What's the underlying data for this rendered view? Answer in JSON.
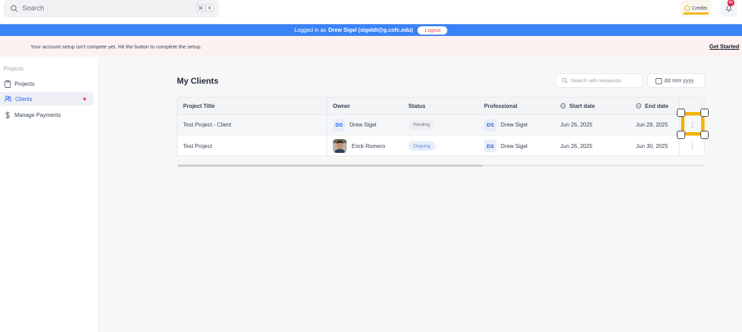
{
  "topbar": {
    "search_placeholder": "Search",
    "shortcut_keys": [
      "⌘",
      "K"
    ],
    "credits_label": "Credits",
    "notification_count": "81"
  },
  "impersonation": {
    "prefix": "Logged in as",
    "user": "Drew Sigel (sigeldt@g.cofc.edu)",
    "logout_label": "Logout"
  },
  "setup_banner": {
    "message": "Your account setup isn't compete yet. Hit the button to complete the setup.",
    "cta": "Get Started"
  },
  "sidebar": {
    "section_title": "Projects",
    "items": [
      {
        "label": "Projects",
        "icon": "clipboard-icon",
        "active": false
      },
      {
        "label": "Clients",
        "icon": "users-icon",
        "active": true
      },
      {
        "label": "Manage Payments",
        "icon": "dollar-icon",
        "active": false
      }
    ]
  },
  "main": {
    "title": "My Clients",
    "keyword_search_placeholder": "Search with keywords",
    "date_placeholder": "dd mm yyyy",
    "columns": [
      "Project Title",
      "Owner",
      "Status",
      "Professional",
      "Start date",
      "End date"
    ],
    "rows": [
      {
        "title": "Test Project - Client",
        "owner_initials": "DS",
        "owner": "Drew Sigel",
        "status": "Pending",
        "pro_initials": "DS",
        "professional": "Drew Sigel",
        "start": "Jun 26, 2025",
        "end": "Jun 28, 2025"
      },
      {
        "title": "Test Project",
        "owner_initials": "",
        "owner": "Erick Romero",
        "status": "Ongoing",
        "pro_initials": "DS",
        "professional": "Drew Sigel",
        "start": "Jun 26, 2025",
        "end": "Jun 30, 2025"
      }
    ]
  },
  "colors": {
    "brand_blue": "#3b82f6",
    "accent_yellow": "#f4b400",
    "danger": "#ef4444"
  }
}
